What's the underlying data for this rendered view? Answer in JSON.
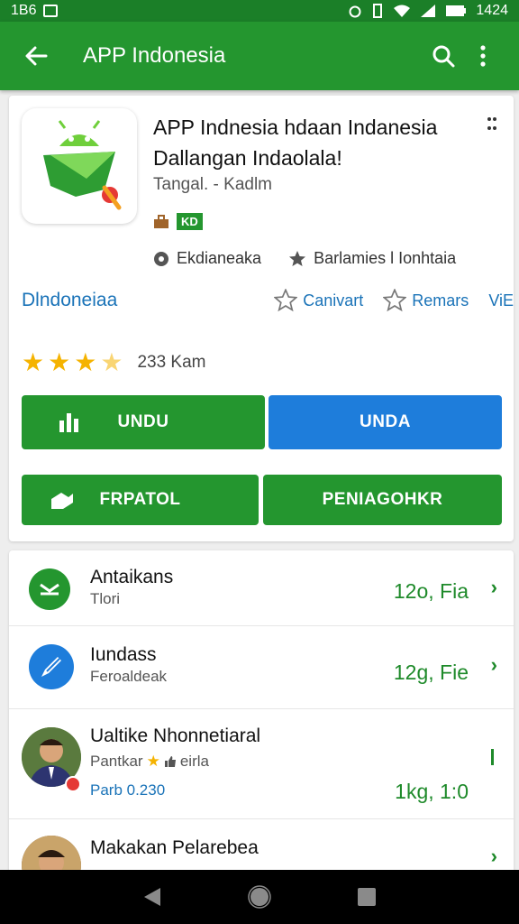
{
  "status_bar": {
    "left_text": "1Β6",
    "time": "1424"
  },
  "app_bar": {
    "title": "APP Indonesia"
  },
  "app": {
    "title": "APP Indnesia hdaan Indanesia Dallangan Indaolala!",
    "developer": "Tangal. - Kadlm",
    "badge": "KD",
    "meta_left": "Ekdianeaka",
    "meta_right": "Barlamies l Ionhtaia"
  },
  "tabs": {
    "main": "Dlndoneiaa",
    "item1": "Canivart",
    "item2": "Remars",
    "item3": "ViE"
  },
  "rating": {
    "stars": 3.5,
    "text": "233 Kam"
  },
  "buttons": {
    "b1": "UNDU",
    "b2": "UNDA",
    "b3": "FRPATOL",
    "b4": "PENIAGOHKR"
  },
  "list": [
    {
      "name": "Antaikans",
      "sub": "Tlori",
      "value": "12o, Fia"
    },
    {
      "name": "Iundass",
      "sub": "Feroaldeak",
      "value": "12g, Fie"
    },
    {
      "name": "Ualtike Nhonnetiaral",
      "sub": "Pantkar",
      "sub2": "eirla",
      "sub_line2": "Parb 0.230",
      "value": "1kg, 1:0"
    },
    {
      "name": "Makakan Pelarebea",
      "sub": "",
      "value": ""
    }
  ],
  "colors": {
    "primary": "#24962f",
    "status": "#1b7f28",
    "blue": "#1e7ddb",
    "link": "#1a73b8",
    "star": "#f5b301"
  }
}
